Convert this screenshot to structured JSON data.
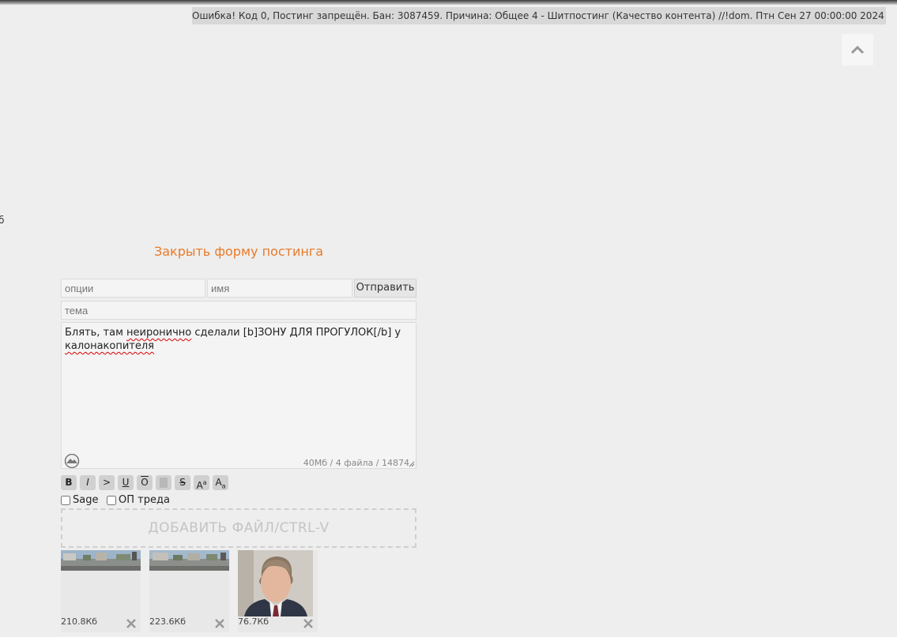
{
  "error_message": "Ошибка! Код 0, Постинг запрещён. Бан: 3087459. Причина: Общее 4 - Шитпостинг (Качество контента) //!dom. Птн Сен 27 00:00:00 2024",
  "stray_text": "б",
  "close_form_label": "Закрыть форму постинга",
  "form": {
    "options_placeholder": "опции",
    "name_placeholder": "имя",
    "send_label": "Отправить",
    "subject_placeholder": "тема",
    "comment": {
      "part1": "Блять, там ",
      "word_neironichno": "неиронично",
      "part2": " сделали [b]ЗОНУ ДЛЯ ПРОГУЛОК[/b] у\n",
      "word_kalonakopitelya": "калонакопителя"
    },
    "limits": "40Мб / 4 файла / 14874"
  },
  "format_buttons": {
    "bold": "B",
    "italic": "I",
    "quote": ">",
    "underline": "U",
    "overline": "O",
    "spoiler": "",
    "strike": "S",
    "sup": "Aa",
    "sub": "Aa"
  },
  "checkboxes": {
    "sage_label": "Sage",
    "op_label": "ОП треда"
  },
  "add_file_label": "ДОБАВИТЬ ФАЙЛ/CTRL-V",
  "attachments": [
    {
      "size": "210.8Кб",
      "kind": "street-photo"
    },
    {
      "size": "223.6Кб",
      "kind": "street-photo"
    },
    {
      "size": "76.7Кб",
      "kind": "portrait-photo"
    }
  ],
  "icons": {
    "scroll_top": "chevron-up-icon",
    "cloud": "cloud-icon",
    "remove": "close-icon"
  }
}
